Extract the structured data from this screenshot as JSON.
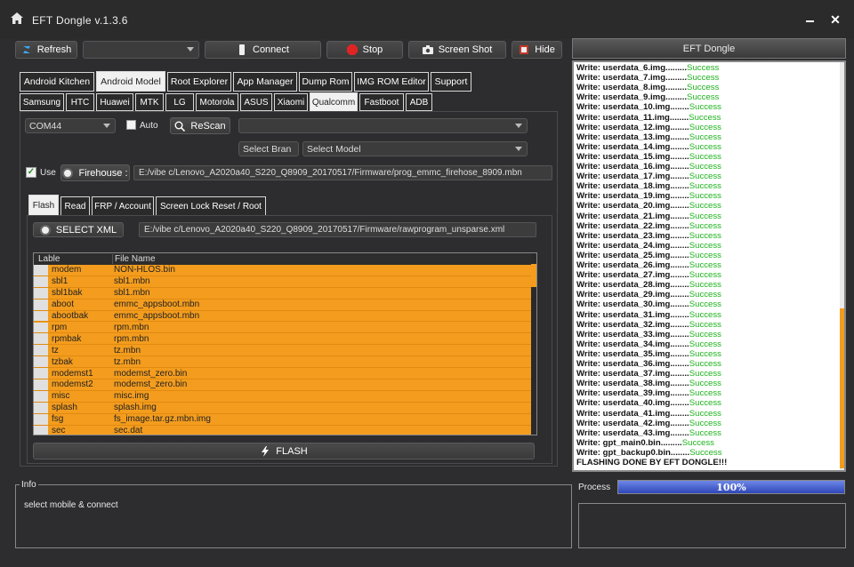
{
  "window": {
    "title": "EFT Dongle  v.1.3.6"
  },
  "toolbar": {
    "refresh": "Refresh",
    "connect": "Connect",
    "stop": "Stop",
    "screenshot": "Screen Shot",
    "hide": "Hide",
    "device_dropdown": ""
  },
  "main_tabs": [
    "Android Kitchen",
    "Android Model",
    "Root Explorer",
    "App Manager",
    "Dump Rom",
    "IMG ROM Editor",
    "Support"
  ],
  "brand_tabs": [
    "Samsung",
    "HTC",
    "Huawei",
    "MTK",
    "LG",
    "Motorola",
    "ASUS",
    "Xiaomi",
    "Qualcomm",
    "Fastboot",
    "ADB"
  ],
  "port": {
    "value": "COM44",
    "auto_label": "Auto",
    "rescan": "ReScan",
    "port_detail": ""
  },
  "select_brand": "Select Bran",
  "select_model": "Select Model",
  "firehose": {
    "use_label": "Use",
    "button": "Firehouse :",
    "path": "E:/vibe c/Lenovo_A2020a40_S220_Q8909_20170517/Firmware/prog_emmc_firehose_8909.mbn"
  },
  "op_tabs": [
    "Flash",
    "Read",
    "FRP / Account",
    "Screen Lock Reset  / Root"
  ],
  "xml": {
    "button": "SELECT XML",
    "path": "E:/vibe c/Lenovo_A2020a40_S220_Q8909_20170517/Firmware/rawprogram_unsparse.xml"
  },
  "table": {
    "headers": [
      "Lable",
      "File Name"
    ],
    "rows": [
      [
        "modem",
        "NON-HLOS.bin"
      ],
      [
        "sbl1",
        "sbl1.mbn"
      ],
      [
        "sbl1bak",
        "sbl1.mbn"
      ],
      [
        "aboot",
        "emmc_appsboot.mbn"
      ],
      [
        "abootbak",
        "emmc_appsboot.mbn"
      ],
      [
        "rpm",
        "rpm.mbn"
      ],
      [
        "rpmbak",
        "rpm.mbn"
      ],
      [
        "tz",
        "tz.mbn"
      ],
      [
        "tzbak",
        "tz.mbn"
      ],
      [
        "modemst1",
        "modemst_zero.bin"
      ],
      [
        "modemst2",
        "modemst_zero.bin"
      ],
      [
        "misc",
        "misc.img"
      ],
      [
        "splash",
        "splash.img"
      ],
      [
        "fsg",
        "fs_image.tar.gz.mbn.img"
      ],
      [
        "sec",
        "sec.dat"
      ]
    ]
  },
  "flash_button": "FLASH",
  "info": {
    "title": "Info",
    "text": "select mobile & connect"
  },
  "log_panel": {
    "title": "EFT Dongle",
    "lines": [
      [
        "Write: userdata_6.img.........",
        "Success"
      ],
      [
        "Write: userdata_7.img.........",
        "Success"
      ],
      [
        "Write: userdata_8.img.........",
        "Success"
      ],
      [
        "Write: userdata_9.img.........",
        "Success"
      ],
      [
        "Write: userdata_10.img........",
        "Success"
      ],
      [
        "Write: userdata_11.img........",
        "Success"
      ],
      [
        "Write: userdata_12.img........",
        "Success"
      ],
      [
        "Write: userdata_13.img........",
        "Success"
      ],
      [
        "Write: userdata_14.img........",
        "Success"
      ],
      [
        "Write: userdata_15.img........",
        "Success"
      ],
      [
        "Write: userdata_16.img........",
        "Success"
      ],
      [
        "Write: userdata_17.img........",
        "Success"
      ],
      [
        "Write: userdata_18.img........",
        "Success"
      ],
      [
        "Write: userdata_19.img........",
        "Success"
      ],
      [
        "Write: userdata_20.img........",
        "Success"
      ],
      [
        "Write: userdata_21.img........",
        "Success"
      ],
      [
        "Write: userdata_22.img........",
        "Success"
      ],
      [
        "Write: userdata_23.img........",
        "Success"
      ],
      [
        "Write: userdata_24.img........",
        "Success"
      ],
      [
        "Write: userdata_25.img........",
        "Success"
      ],
      [
        "Write: userdata_26.img........",
        "Success"
      ],
      [
        "Write: userdata_27.img........",
        "Success"
      ],
      [
        "Write: userdata_28.img........",
        "Success"
      ],
      [
        "Write: userdata_29.img........",
        "Success"
      ],
      [
        "Write: userdata_30.img........",
        "Success"
      ],
      [
        "Write: userdata_31.img........",
        "Success"
      ],
      [
        "Write: userdata_32.img........",
        "Success"
      ],
      [
        "Write: userdata_33.img........",
        "Success"
      ],
      [
        "Write: userdata_34.img........",
        "Success"
      ],
      [
        "Write: userdata_35.img........",
        "Success"
      ],
      [
        "Write: userdata_36.img........",
        "Success"
      ],
      [
        "Write: userdata_37.img........",
        "Success"
      ],
      [
        "Write: userdata_38.img........",
        "Success"
      ],
      [
        "Write: userdata_39.img........",
        "Success"
      ],
      [
        "Write: userdata_40.img........",
        "Success"
      ],
      [
        "Write: userdata_41.img........",
        "Success"
      ],
      [
        "Write: userdata_42.img........",
        "Success"
      ],
      [
        "Write: userdata_43.img........",
        "Success"
      ],
      [
        "Write: gpt_main0.bin.........",
        "Success"
      ],
      [
        "Write: gpt_backup0.bin........",
        "Success"
      ],
      [
        "FLASHING DONE BY EFT DONGLE!!!",
        ""
      ]
    ]
  },
  "process": {
    "label": "Process",
    "percent_text": "100%",
    "progress": 1.0
  },
  "colors": {
    "table_fill": "#f39c1e",
    "success": "#1db31d",
    "progress": "#3a55c8"
  }
}
